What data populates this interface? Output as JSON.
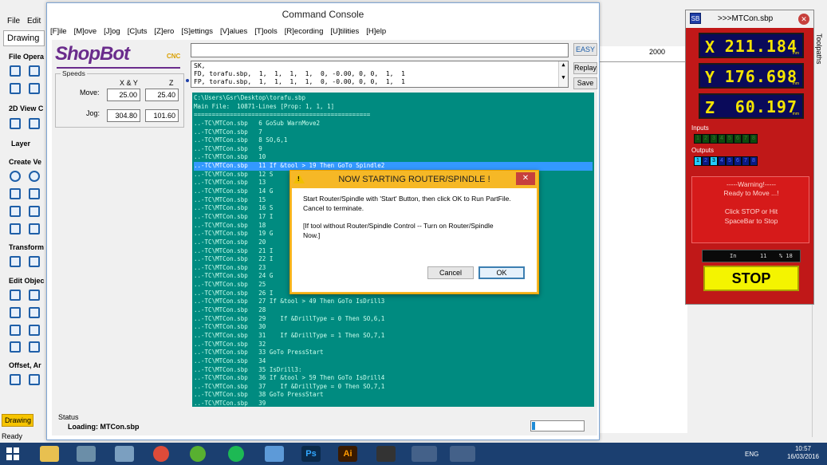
{
  "bg_app": {
    "menu": [
      "File",
      "Edit"
    ],
    "tab": "Drawing",
    "sections": [
      "File Opera",
      "2D View C",
      "Layer",
      "Create Ve",
      "Transform",
      "Edit Objec",
      "Offset, Ar"
    ],
    "ruler_label": "2000",
    "right_tab": "Toolpaths",
    "drawing_tab": "Drawing",
    "status": "Ready"
  },
  "console": {
    "title": "Command Console",
    "menu": [
      "[F]ile",
      "[M]ove",
      "[J]og",
      "[C]uts",
      "[Z]ero",
      "[S]ettings",
      "[V]alues",
      "[T]ools",
      "[R]ecording",
      "[U]tilities",
      "[H]elp"
    ],
    "logo": {
      "text": "ShopBot",
      "suffix": "CNC"
    },
    "speeds": {
      "legend": "Speeds",
      "col_xy": "X & Y",
      "col_z": "Z",
      "move_label": "Move:",
      "jog_label": "Jog:",
      "move_xy": "25.00",
      "move_z": "25.40",
      "jog_xy": "304.80",
      "jog_z": "101.60"
    },
    "command_input": "",
    "easy_label": "EASY",
    "replay_label": "Replay",
    "save_label": "Save",
    "history": [
      "SK,",
      "FD, torafu.sbp,  1,  1,  1,  1,  0, -0.00, 0, 0,  1,  1",
      "FP, torafu.sbp,  1,  1,  1,  1,  0, -0.00, 0, 0,  1,  1"
    ],
    "listing": [
      {
        "t": "C:\\Users\\Gsr\\Desktop\\torafu.sbp",
        "hl": false
      },
      {
        "t": "Main File:  10871-Lines [Prop: 1, 1, 1]",
        "hl": false
      },
      {
        "t": "=================================================",
        "hl": false
      },
      {
        "t": "..-TC\\MTCon.sbp   6 GoSub WarnMove2",
        "hl": false
      },
      {
        "t": "..-TC\\MTCon.sbp   7",
        "hl": false
      },
      {
        "t": "..-TC\\MTCon.sbp   8 SO,6,1",
        "hl": false
      },
      {
        "t": "..-TC\\MTCon.sbp   9",
        "hl": false
      },
      {
        "t": "..-TC\\MTCon.sbp   10",
        "hl": false
      },
      {
        "t": "..-TC\\MTCon.sbp   11 If &tool > 19 Then GoTo Spindle2",
        "hl": true
      },
      {
        "t": "..-TC\\MTCon.sbp   12 S",
        "hl": false
      },
      {
        "t": "..-TC\\MTCon.sbp   13",
        "hl": false
      },
      {
        "t": "..-TC\\MTCon.sbp   14 G",
        "hl": false
      },
      {
        "t": "..-TC\\MTCon.sbp   15",
        "hl": false
      },
      {
        "t": "..-TC\\MTCon.sbp   16 S",
        "hl": false
      },
      {
        "t": "..-TC\\MTCon.sbp   17 I",
        "hl": false
      },
      {
        "t": "..-TC\\MTCon.sbp   18",
        "hl": false
      },
      {
        "t": "..-TC\\MTCon.sbp   19 G",
        "hl": false
      },
      {
        "t": "..-TC\\MTCon.sbp   20",
        "hl": false
      },
      {
        "t": "..-TC\\MTCon.sbp   21 I",
        "hl": false
      },
      {
        "t": "..-TC\\MTCon.sbp   22 I",
        "hl": false
      },
      {
        "t": "..-TC\\MTCon.sbp   23",
        "hl": false
      },
      {
        "t": "..-TC\\MTCon.sbp   24 G",
        "hl": false
      },
      {
        "t": "..-TC\\MTCon.sbp   25",
        "hl": false
      },
      {
        "t": "..-TC\\MTCon.sbp   26 I",
        "hl": false
      },
      {
        "t": "..-TC\\MTCon.sbp   27 If &tool > 49 Then GoTo IsDrill3",
        "hl": false
      },
      {
        "t": "..-TC\\MTCon.sbp   28",
        "hl": false
      },
      {
        "t": "..-TC\\MTCon.sbp   29    If &DrillType = 0 Then SO,6,1",
        "hl": false
      },
      {
        "t": "..-TC\\MTCon.sbp   30",
        "hl": false
      },
      {
        "t": "..-TC\\MTCon.sbp   31    If &DrillType = 1 Then SO,7,1",
        "hl": false
      },
      {
        "t": "..-TC\\MTCon.sbp   32",
        "hl": false
      },
      {
        "t": "..-TC\\MTCon.sbp   33 GoTo PressStart",
        "hl": false
      },
      {
        "t": "..-TC\\MTCon.sbp   34",
        "hl": false
      },
      {
        "t": "..-TC\\MTCon.sbp   35 IsDrill3:",
        "hl": false
      },
      {
        "t": "..-TC\\MTCon.sbp   36 If &tool > 59 Then GoTo IsDrill4",
        "hl": false
      },
      {
        "t": "..-TC\\MTCon.sbp   37    If &DrillType = 0 Then SO,7,1",
        "hl": false
      },
      {
        "t": "..-TC\\MTCon.sbp   38 GoTo PressStart",
        "hl": false
      },
      {
        "t": "..-TC\\MTCon.sbp   39",
        "hl": false
      }
    ],
    "status_label": "Status",
    "status_text": "Loading: MTCon.sbp",
    "progress": 0.06
  },
  "dialog": {
    "title": "NOW STARTING ROUTER/SPINDLE !",
    "line1": "Start Router/Spindle with 'Start' Button, then click OK to Run PartFile.",
    "line2": "Cancel to terminate.",
    "line3": "[If tool without Router/Spindle Control -- Turn on Router/Spindle",
    "line4": "Now.]",
    "cancel_label": "Cancel",
    "ok_label": "OK",
    "close_glyph": "✕"
  },
  "mtcon": {
    "title": ">>>MTCon.sbp",
    "close_glyph": "✕",
    "axes": [
      {
        "name": "X",
        "value": "211.184",
        "unit": "mm"
      },
      {
        "name": "Y",
        "value": "176.698",
        "unit": "mm"
      },
      {
        "name": "Z",
        "value": "60.197",
        "unit": "mm"
      }
    ],
    "inputs_label": "Inputs",
    "inputs": [
      "1",
      "2",
      "3",
      "4",
      "5",
      "6",
      "7",
      "8"
    ],
    "outputs_label": "Outputs",
    "outputs": [
      "1",
      "2",
      "3",
      "4",
      "5",
      "6",
      "7",
      "8"
    ],
    "outputs_on": [
      0,
      2
    ],
    "msg": [
      "-----Warning!-----",
      "Ready to Move ...!",
      "",
      "Click STOP or Hit",
      "SpaceBar to Stop"
    ],
    "units": "In",
    "units_val1": "11",
    "units_val2": "% 18",
    "stop_label": "STOP"
  },
  "taskbar": {
    "lang": "ENG",
    "time": "10:57",
    "date": "16/03/2016",
    "apps": [
      "explorer",
      "tool",
      "files",
      "chrome",
      "utorrent",
      "spotify",
      "photos",
      "Ps",
      "Ai",
      "inkscape",
      "aspire",
      "shopbot"
    ]
  }
}
